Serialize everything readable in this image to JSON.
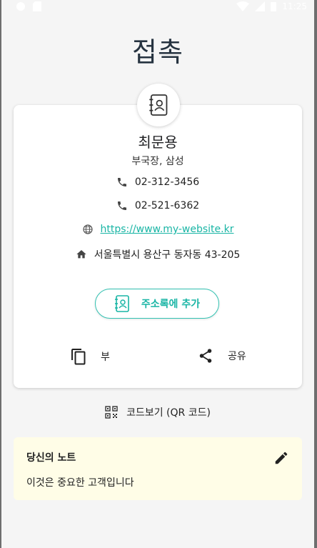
{
  "status_bar": {
    "time": "11:25"
  },
  "page": {
    "title": "접촉"
  },
  "contact": {
    "name": "최문용",
    "subtitle": "부국장, 삼성",
    "phone_1": "02-312-3456",
    "phone_2": "02-521-6362",
    "website": "https://www.my-website.kr",
    "address": "서울특별시 용산구 동자동 43-205"
  },
  "actions": {
    "add_contact_label": "주소록에 추가",
    "copy_label": "부",
    "share_label": "공유"
  },
  "qr": {
    "label": "코드보기 (QR 코드)"
  },
  "note": {
    "title": "당신의 노트",
    "text": "이것은 중요한 고객입니다"
  },
  "colors": {
    "accent": "#19b5a5",
    "title": "#263340",
    "note_background": "#fffde7",
    "screen_background": "#f5f5f5"
  }
}
